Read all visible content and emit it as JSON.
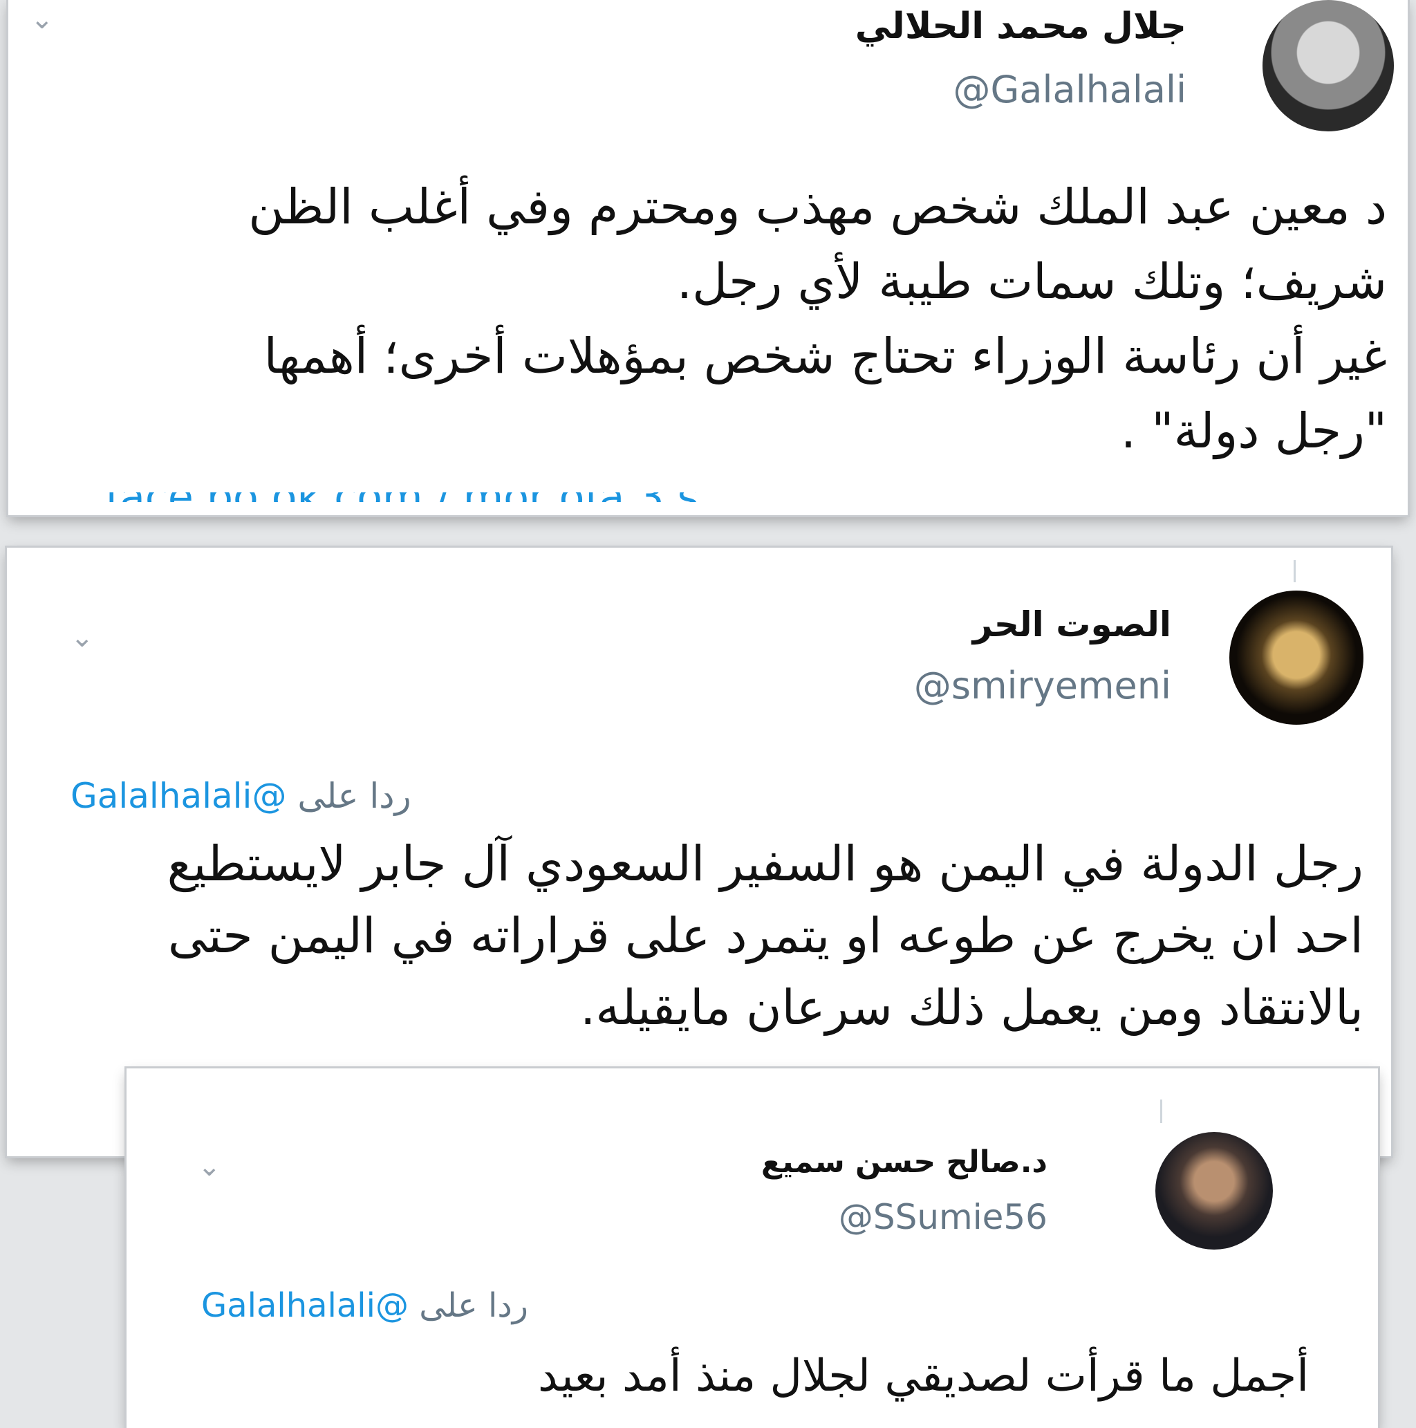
{
  "tweets": [
    {
      "name": "جلال محمد الحلالي",
      "handle": "@Galalhalali",
      "body": "د معين عبد الملك شخص مهذب ومحترم وفي أغلب الظن\nشريف؛ وتلك سمات طيبة لأي رجل.\nغير أن رئاسة الوزراء تحتاج شخص  بمؤهلات أخرى؛ أهمها\n\"رجل دولة\" .",
      "menu_icon": "chevron-down-icon"
    },
    {
      "name": "الصوت الحر",
      "handle": "@smiryemeni",
      "reply_prefix": "ردا على",
      "reply_mention": "@Galalhalali",
      "body": "رجل الدولة في اليمن هو السفير السعودي آل جابر لايستطيع\nاحد ان يخرج عن طوعه او يتمرد على قراراته في اليمن حتى\nبالانتقاد ومن يعمل ذلك سرعان مايقيله.",
      "menu_icon": "chevron-down-icon"
    },
    {
      "name": "د.صالح حسن سميع",
      "handle": "@SSumie56",
      "reply_prefix": "ردا على",
      "reply_mention": "@Galalhalali",
      "body": "أجمل ما قرأت لصديقي لجلال منذ أمد بعيد",
      "menu_icon": "chevron-down-icon"
    }
  ],
  "colors": {
    "link": "#1b95e0",
    "muted": "#657786",
    "text": "#111111"
  }
}
